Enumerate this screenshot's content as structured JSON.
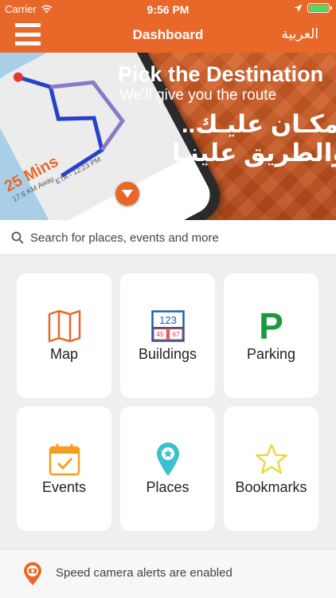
{
  "status_bar": {
    "carrier": "Carrier",
    "time": "9:56 PM"
  },
  "nav": {
    "title": "Dashboard",
    "language": "العربية"
  },
  "banner": {
    "headline": "Pick the Destination",
    "subline": "We’ll give you the route",
    "arabic_line1": "المكـان عليـك..",
    "arabic_line2": "والطريق علينـا",
    "duration": "25 Mins",
    "distance": "17.6 KM Away",
    "eta": "ETA - 12:23 PM",
    "pages": 2,
    "active_page": 0
  },
  "search": {
    "placeholder": "Search for places, events and more"
  },
  "tiles": [
    {
      "label": "Map",
      "icon": "map-icon"
    },
    {
      "label": "Buildings",
      "icon": "buildings-icon",
      "icon_text": [
        "123",
        "45",
        "67"
      ]
    },
    {
      "label": "Parking",
      "icon": "parking-icon",
      "icon_text": "P"
    },
    {
      "label": "Events",
      "icon": "calendar-check-icon"
    },
    {
      "label": "Places",
      "icon": "place-pin-icon"
    },
    {
      "label": "Bookmarks",
      "icon": "star-icon"
    }
  ],
  "footer": {
    "text": "Speed camera alerts are enabled",
    "icon": "speed-camera-icon"
  },
  "colors": {
    "brand": "#e8682a",
    "buildings_blue": "#1e5fa8",
    "parking_green": "#1a9a3e",
    "events_orange": "#f0a020",
    "places_teal": "#3cbfcf",
    "bookmark_yellow": "#e8d94a"
  }
}
